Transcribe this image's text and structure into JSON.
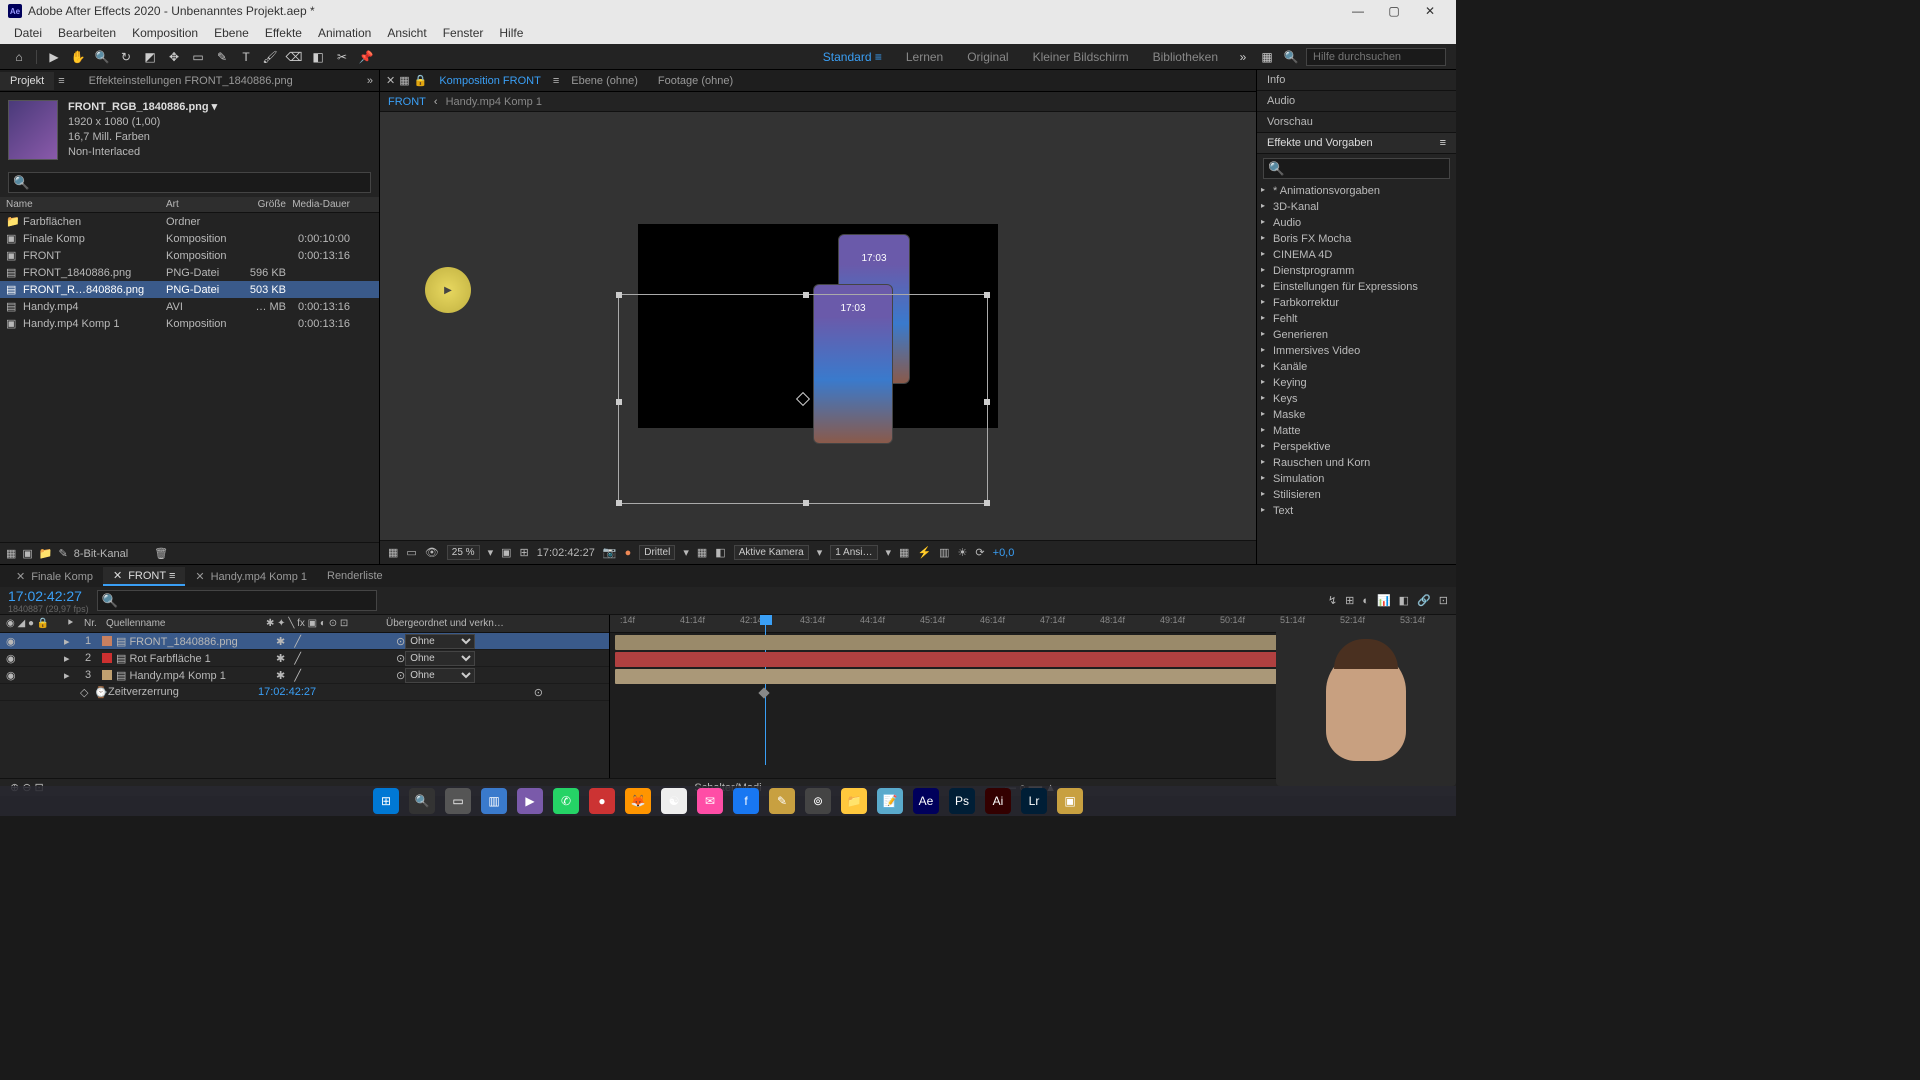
{
  "titlebar": {
    "app": "Adobe After Effects 2020 - Unbenanntes Projekt.aep *"
  },
  "menu": [
    "Datei",
    "Bearbeiten",
    "Komposition",
    "Ebene",
    "Effekte",
    "Animation",
    "Ansicht",
    "Fenster",
    "Hilfe"
  ],
  "workspaces": {
    "items": [
      "Standard",
      "Lernen",
      "Original",
      "Kleiner Bildschirm",
      "Bibliotheken"
    ],
    "active": "Standard",
    "search_placeholder": "Hilfe durchsuchen"
  },
  "project": {
    "tab": "Projekt",
    "effect_tab": "Effekteinstellungen FRONT_1840886.png",
    "asset": {
      "name": "FRONT_RGB_1840886.png ▾",
      "dims": "1920 x 1080 (1,00)",
      "colors": "16,7 Mill. Farben",
      "interlace": "Non-Interlaced"
    },
    "columns": {
      "name": "Name",
      "type": "Art",
      "size": "Größe",
      "dur": "Media-Dauer"
    },
    "items": [
      {
        "icon": "📁",
        "name": "Farbflächen",
        "type": "Ordner",
        "size": "",
        "dur": ""
      },
      {
        "icon": "▣",
        "name": "Finale Komp",
        "type": "Komposition",
        "size": "",
        "dur": "0:00:10:00"
      },
      {
        "icon": "▣",
        "name": "FRONT",
        "type": "Komposition",
        "size": "",
        "dur": "0:00:13:16"
      },
      {
        "icon": "▤",
        "name": "FRONT_1840886.png",
        "type": "PNG-Datei",
        "size": "596 KB",
        "dur": ""
      },
      {
        "icon": "▤",
        "name": "FRONT_R…840886.png",
        "type": "PNG-Datei",
        "size": "503 KB",
        "dur": "",
        "selected": true
      },
      {
        "icon": "▤",
        "name": "Handy.mp4",
        "type": "AVI",
        "size": "… MB",
        "dur": "0:00:13:16"
      },
      {
        "icon": "▣",
        "name": "Handy.mp4 Komp 1",
        "type": "Komposition",
        "size": "",
        "dur": "0:00:13:16"
      }
    ],
    "bitdepth": "8-Bit-Kanal"
  },
  "comp": {
    "tab_label": "Komposition FRONT",
    "layer_tab": "Ebene (ohne)",
    "footage_tab": "Footage (ohne)",
    "breadcrumbs": [
      "FRONT",
      "Handy.mp4 Komp 1"
    ],
    "phone_time1": "17:03",
    "phone_time2": "17:03",
    "zoom": "25 %",
    "timecode": "17:02:42:27",
    "res": "Drittel",
    "camera": "Aktive Kamera",
    "views": "1 Ansi…",
    "exposure": "+0,0"
  },
  "right": {
    "sections": [
      "Info",
      "Audio",
      "Vorschau"
    ],
    "effects_title": "Effekte und Vorgaben",
    "items": [
      "* Animationsvorgaben",
      "3D-Kanal",
      "Audio",
      "Boris FX Mocha",
      "CINEMA 4D",
      "Dienstprogramm",
      "Einstellungen für Expressions",
      "Farbkorrektur",
      "Fehlt",
      "Generieren",
      "Immersives Video",
      "Kanäle",
      "Keying",
      "Keys",
      "Maske",
      "Matte",
      "Perspektive",
      "Rauschen und Korn",
      "Simulation",
      "Stilisieren",
      "Text"
    ]
  },
  "timeline": {
    "tabs": [
      "Finale Komp",
      "FRONT",
      "Handy.mp4 Komp 1",
      "Renderliste"
    ],
    "active_tab": "FRONT",
    "time": "17:02:42:27",
    "fps_note": "1840887 (29,97 fps)",
    "cols": {
      "nr": "Nr.",
      "source": "Quellenname",
      "parent": "Übergeordnet und verkn…"
    },
    "parent_none": "Ohne",
    "layers": [
      {
        "num": "1",
        "color": "#c88060",
        "name": "FRONT_1840886.png",
        "selected": true
      },
      {
        "num": "2",
        "color": "#cc3030",
        "name": "Rot Farbfläche 1"
      },
      {
        "num": "3",
        "color": "#c0a070",
        "name": "Handy.mp4 Komp 1"
      }
    ],
    "prop": {
      "name": "Zeitverzerrung",
      "value": "17:02:42:27"
    },
    "ticks": [
      ":14f",
      "41:14f",
      "42:14f",
      "43:14f",
      "44:14f",
      "45:14f",
      "46:14f",
      "47:14f",
      "48:14f",
      "49:14f",
      "50:14f",
      "51:14f",
      "52:14f",
      "53:14f"
    ],
    "footer": "Schalter/Modi"
  },
  "taskbar_icons": [
    {
      "bg": "#0078d4",
      "t": "⊞"
    },
    {
      "bg": "#333",
      "t": "🔍"
    },
    {
      "bg": "#555",
      "t": "▭"
    },
    {
      "bg": "#3a7acc",
      "t": "▥"
    },
    {
      "bg": "#7a5aaa",
      "t": "▶"
    },
    {
      "bg": "#25d366",
      "t": "✆"
    },
    {
      "bg": "#cc3333",
      "t": "●"
    },
    {
      "bg": "#ff9500",
      "t": "🦊"
    },
    {
      "bg": "#eee",
      "t": "☯"
    },
    {
      "bg": "#ff4da6",
      "t": "✉"
    },
    {
      "bg": "#1877f2",
      "t": "f"
    },
    {
      "bg": "#c8a040",
      "t": "✎"
    },
    {
      "bg": "#444",
      "t": "⊚"
    },
    {
      "bg": "#ffc83d",
      "t": "📁"
    },
    {
      "bg": "#5aaacc",
      "t": "📝"
    },
    {
      "bg": "#00005b",
      "t": "Ae"
    },
    {
      "bg": "#001e36",
      "t": "Ps"
    },
    {
      "bg": "#330000",
      "t": "Ai"
    },
    {
      "bg": "#001e36",
      "t": "Lr"
    },
    {
      "bg": "#c8a040",
      "t": "▣"
    }
  ]
}
